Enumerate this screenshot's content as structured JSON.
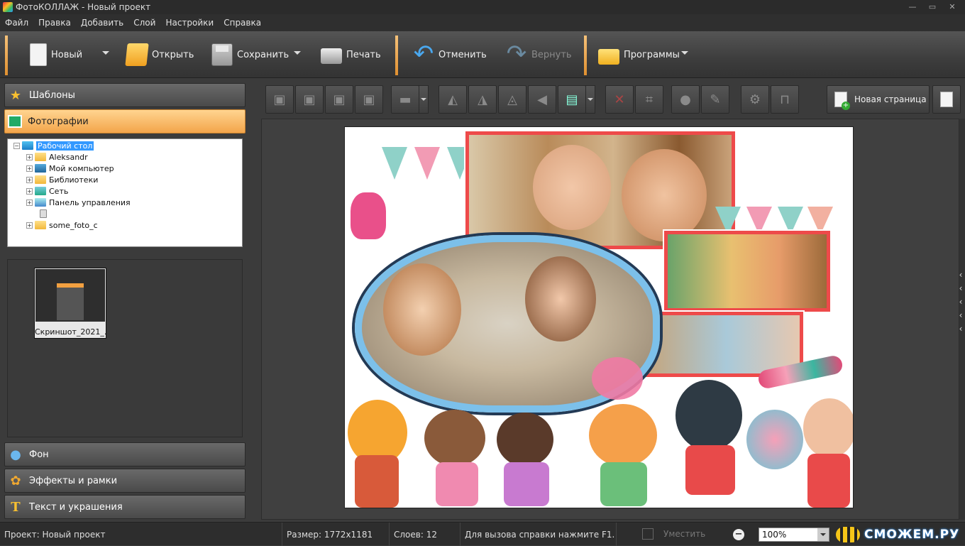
{
  "window": {
    "title": "ФотоКОЛЛАЖ - Новый проект",
    "controls": [
      "—",
      "▭",
      "✕"
    ]
  },
  "menu": [
    "Файл",
    "Правка",
    "Добавить",
    "Слой",
    "Настройки",
    "Справка"
  ],
  "toolbar": {
    "new": "Новый",
    "open": "Открыть",
    "save": "Сохранить",
    "print": "Печать",
    "undo": "Отменить",
    "redo": "Вернуть",
    "programs": "Программы"
  },
  "sidebar": {
    "templates": "Шаблоны",
    "photos": "Фотографии",
    "background": "Фон",
    "effects": "Эффекты и рамки",
    "text": "Текст и украшения",
    "tree": [
      {
        "label": "Рабочий стол",
        "icon": "desktop-icon",
        "selected": true
      },
      {
        "label": "Aleksandr",
        "icon": "folder-icon"
      },
      {
        "label": "Мой компьютер",
        "icon": "computer-icon"
      },
      {
        "label": "Библиотеки",
        "icon": "folder-icon"
      },
      {
        "label": "Сеть",
        "icon": "network-icon"
      },
      {
        "label": "Панель управления",
        "icon": "control-panel-icon"
      },
      {
        "label": "",
        "icon": "recycle-bin-icon"
      },
      {
        "label": "some_foto_c",
        "icon": "folder-icon"
      }
    ],
    "thumbnail": {
      "label": "Скриншот_2021_..."
    }
  },
  "editbar": {
    "new_page": "Новая страница",
    "icons": [
      "bring-front-icon",
      "bring-forward-icon",
      "send-backward-icon",
      "send-back-icon",
      "align-icon",
      "rotate-left-icon",
      "rotate-right-icon",
      "flip-horizontal-icon",
      "flip-vertical-icon",
      "fit-icon",
      "delete-icon",
      "crop-icon",
      "color-icon",
      "clean-icon",
      "settings-icon",
      "lock-icon"
    ]
  },
  "status": {
    "project_label": "Проект:",
    "project_value": "Новый проект",
    "size_label": "Размер:",
    "size_value": "1772x1181",
    "layers_label": "Слоев:",
    "layers_value": "12",
    "hint": "Для вызова справки нажмите F1.",
    "fit": "Уместить",
    "zoom": "100%",
    "brand": "СМОЖЕМ.РУ"
  },
  "colors": {
    "accent": "#f3a54a",
    "selection": "#3399ff",
    "frame_red": "#ee4a4a",
    "cloud_blue": "#7cc0ea"
  }
}
